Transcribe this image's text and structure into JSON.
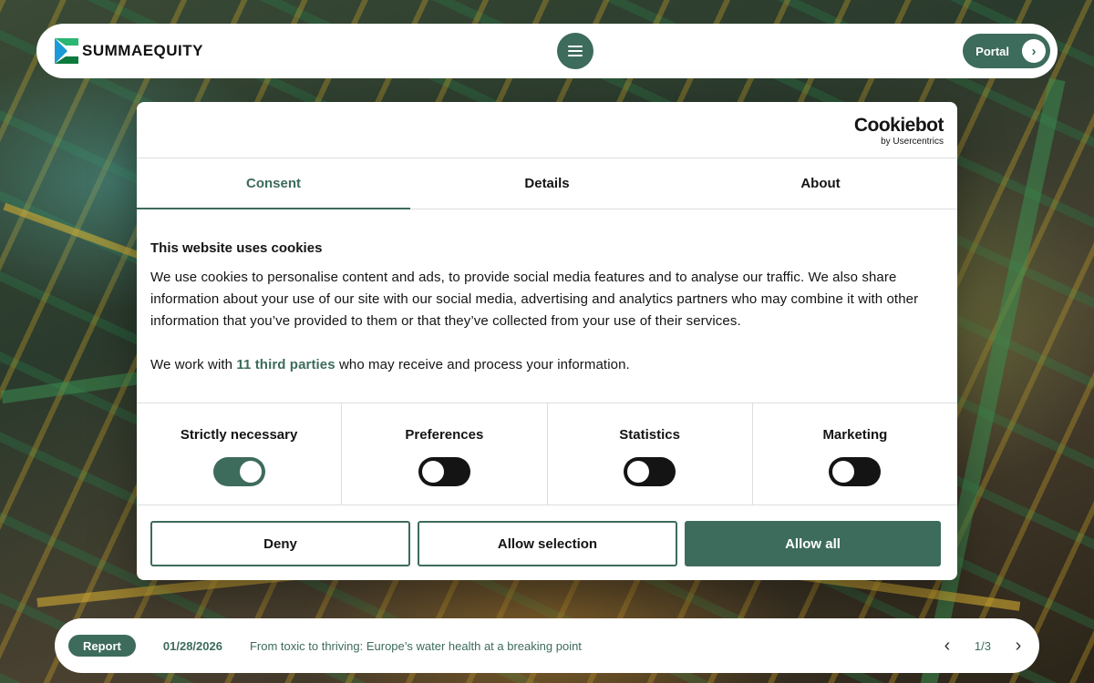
{
  "header": {
    "brand": "SUMMAEQUITY",
    "portal_label": "Portal"
  },
  "dialog": {
    "provider": "Cookiebot",
    "provider_sub": "by Usercentrics",
    "tabs": [
      {
        "label": "Consent"
      },
      {
        "label": "Details"
      },
      {
        "label": "About"
      }
    ],
    "heading": "This website uses cookies",
    "paragraph": "We use cookies to personalise content and ads, to provide social media features and to analyse our traffic. We also share information about your use of our site with our social media, advertising and analytics partners who may combine it with other information that you’ve provided to them or that they’ve collected from your use of their services.",
    "third_party_prefix": "We work with ",
    "third_party_link": "11 third parties",
    "third_party_suffix": " who may receive and process your information.",
    "categories": [
      {
        "label": "Strictly necessary",
        "enabled": true
      },
      {
        "label": "Preferences",
        "enabled": false
      },
      {
        "label": "Statistics",
        "enabled": false
      },
      {
        "label": "Marketing",
        "enabled": false
      }
    ],
    "buttons": {
      "deny": "Deny",
      "allow_selection": "Allow selection",
      "allow_all": "Allow all"
    }
  },
  "newsbar": {
    "badge": "Report",
    "date": "01/28/2026",
    "title": "From toxic to thriving: Europe’s water health at a breaking point",
    "page": "1/3"
  },
  "colors": {
    "accent": "#3d6b5c",
    "text": "#141414"
  }
}
